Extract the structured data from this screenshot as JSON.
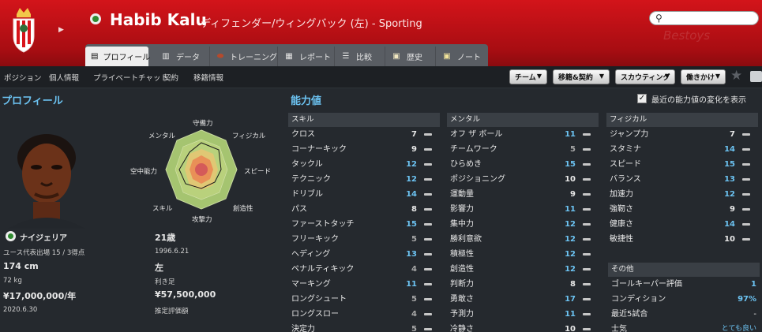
{
  "header": {
    "player_name": "Habib Kalu",
    "role": "ディフェンダー/ウィングバック (左) - Sporting",
    "watermark": "Bestoys"
  },
  "tabs": [
    {
      "label": "プロフィール",
      "icon": "profile-icon",
      "active": true
    },
    {
      "label": "データ",
      "icon": "data-icon"
    },
    {
      "label": "トレーニング",
      "icon": "training-icon"
    },
    {
      "label": "レポート",
      "icon": "report-icon"
    },
    {
      "label": "比較",
      "icon": "compare-icon"
    },
    {
      "label": "歴史",
      "icon": "history-icon"
    },
    {
      "label": "ノート",
      "icon": "notes-icon"
    }
  ],
  "subnav": {
    "items": [
      "ポジション",
      "個人情報",
      "プライベートチャット",
      "契約",
      "移籍情報"
    ],
    "dropdowns": [
      "チーム",
      "移籍&契約",
      "スカウティング",
      "働きかけ"
    ]
  },
  "profile": {
    "title": "プロフィール",
    "radar_labels": {
      "top": "守備力",
      "top_right": "フィジカル",
      "right": "スピード",
      "bottom_right": "創造性",
      "bottom": "攻撃力",
      "bottom_left": "スキル",
      "left": "空中能力",
      "top_left": "メンタル"
    },
    "nationality": "ナイジェリア",
    "youth_caps": "ユース代表出場 15 / 3得点",
    "height": "174 cm",
    "weight": "72 kg",
    "wage": "¥17,000,000/年",
    "contract_end": "2020.6.30",
    "age": "21歳",
    "birthdate": "1996.6.21",
    "foot": "左",
    "foot_label": "利き足",
    "value": "¥57,500,000",
    "value_label": "推定評価額"
  },
  "attributes": {
    "title": "能力値",
    "show_changes_label": "最近の能力値の変化を表示",
    "show_changes_checked": true,
    "technical": {
      "header": "スキル",
      "rows": [
        {
          "name": "クロス",
          "value": "7"
        },
        {
          "name": "コーナーキック",
          "value": "9"
        },
        {
          "name": "タックル",
          "value": "12"
        },
        {
          "name": "テクニック",
          "value": "12"
        },
        {
          "name": "ドリブル",
          "value": "14"
        },
        {
          "name": "パス",
          "value": "8"
        },
        {
          "name": "ファーストタッチ",
          "value": "15"
        },
        {
          "name": "フリーキック",
          "value": "5"
        },
        {
          "name": "ヘディング",
          "value": "13"
        },
        {
          "name": "ペナルティキック",
          "value": "4"
        },
        {
          "name": "マーキング",
          "value": "11"
        },
        {
          "name": "ロングシュート",
          "value": "5"
        },
        {
          "name": "ロングスロー",
          "value": "4"
        },
        {
          "name": "決定力",
          "value": "5"
        }
      ]
    },
    "mental": {
      "header": "メンタル",
      "rows": [
        {
          "name": "オフ ザ ボール",
          "value": "11"
        },
        {
          "name": "チームワーク",
          "value": "5"
        },
        {
          "name": "ひらめき",
          "value": "15"
        },
        {
          "name": "ポジショニング",
          "value": "10"
        },
        {
          "name": "運動量",
          "value": "9"
        },
        {
          "name": "影響力",
          "value": "11"
        },
        {
          "name": "集中力",
          "value": "12"
        },
        {
          "name": "勝利意欲",
          "value": "12"
        },
        {
          "name": "積極性",
          "value": "12"
        },
        {
          "name": "創造性",
          "value": "12"
        },
        {
          "name": "判断力",
          "value": "8"
        },
        {
          "name": "勇敢さ",
          "value": "17"
        },
        {
          "name": "予測力",
          "value": "11"
        },
        {
          "name": "冷静さ",
          "value": "10"
        }
      ]
    },
    "physical": {
      "header": "フィジカル",
      "rows": [
        {
          "name": "ジャンプ力",
          "value": "7"
        },
        {
          "name": "スタミナ",
          "value": "14"
        },
        {
          "name": "スピード",
          "value": "15"
        },
        {
          "name": "バランス",
          "value": "13"
        },
        {
          "name": "加速力",
          "value": "12"
        },
        {
          "name": "強靭さ",
          "value": "9"
        },
        {
          "name": "健康さ",
          "value": "14"
        },
        {
          "name": "敏捷性",
          "value": "10"
        }
      ]
    },
    "other": {
      "header": "その他",
      "rows": [
        {
          "name": "ゴールキーパー評価",
          "value": "1"
        },
        {
          "name": "コンディション",
          "value": "97%"
        },
        {
          "name": "最近5試合",
          "value": "-"
        },
        {
          "name": "士気",
          "value": "とても良い"
        }
      ]
    }
  }
}
